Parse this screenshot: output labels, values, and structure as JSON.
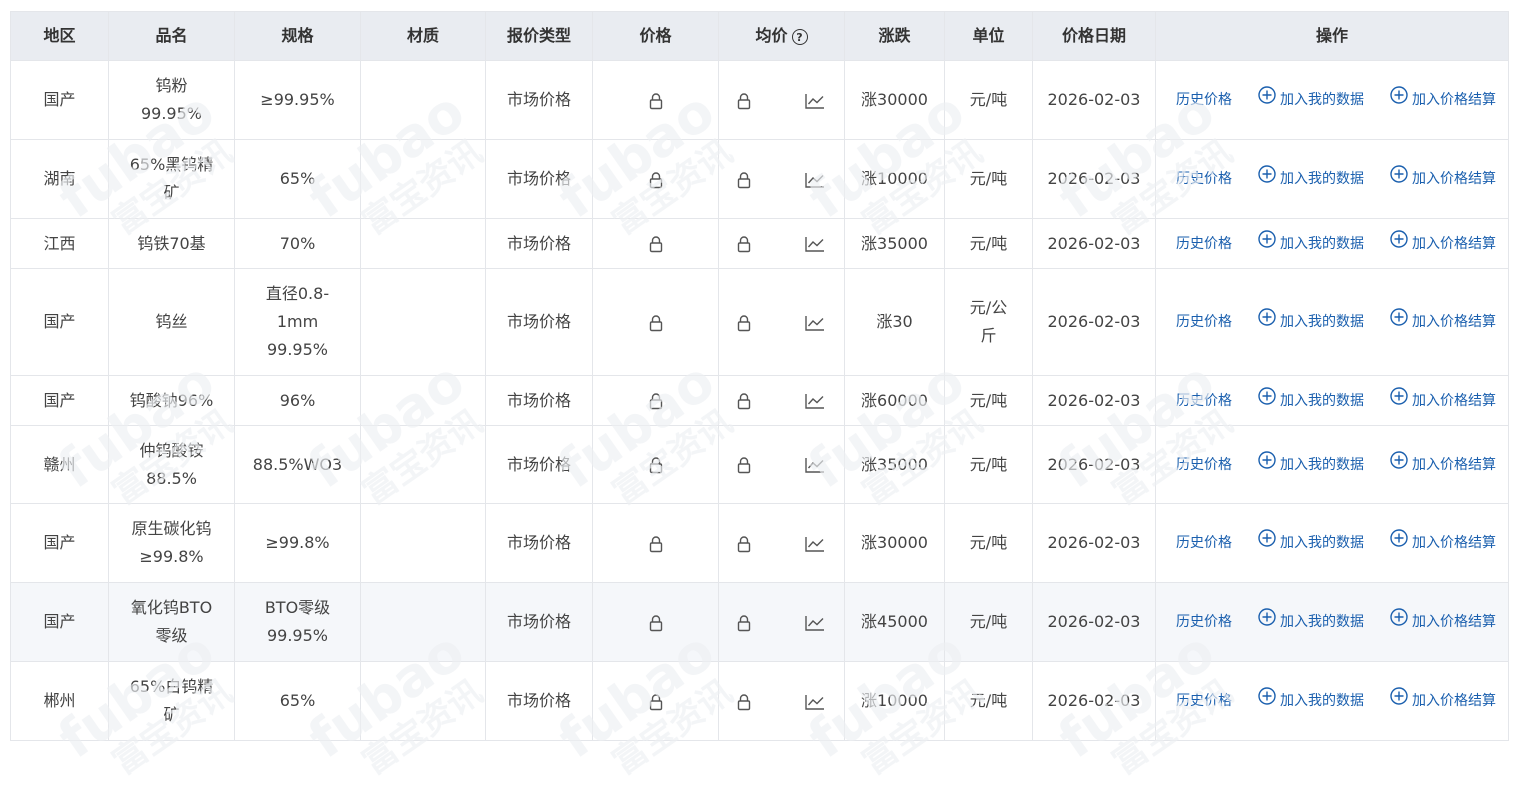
{
  "table": {
    "headers": [
      "地区",
      "品名",
      "规格",
      "材质",
      "报价类型",
      "价格",
      "均价",
      "涨跌",
      "单位",
      "价格日期",
      "操作"
    ],
    "help_glyph": "?",
    "actions": {
      "history": "历史价格",
      "add_data": "加入我的数据",
      "add_settle": "加入价格结算"
    },
    "rows": [
      {
        "region": "国产",
        "name": "钨粉\n99.95%",
        "spec": "≥99.95%",
        "material": "",
        "type": "市场价格",
        "change": "涨30000",
        "unit": "元/吨",
        "date": "2026-02-03",
        "h": 79
      },
      {
        "region": "湖南",
        "name": "65%黑钨精\n矿",
        "spec": "65%",
        "material": "",
        "type": "市场价格",
        "change": "涨10000",
        "unit": "元/吨",
        "date": "2026-02-03",
        "h": 79
      },
      {
        "region": "江西",
        "name": "钨铁70基",
        "spec": "70%",
        "material": "",
        "type": "市场价格",
        "change": "涨35000",
        "unit": "元/吨",
        "date": "2026-02-03",
        "h": 50
      },
      {
        "region": "国产",
        "name": "钨丝",
        "spec": "直径0.8-\n1mm\n99.95%",
        "material": "",
        "type": "市场价格",
        "change": "涨30",
        "unit": "元/公\n斤",
        "date": "2026-02-03",
        "h": 107
      },
      {
        "region": "国产",
        "name": "钨酸钠96%",
        "spec": "96%",
        "material": "",
        "type": "市场价格",
        "change": "涨60000",
        "unit": "元/吨",
        "date": "2026-02-03",
        "h": 50
      },
      {
        "region": "赣州",
        "name": "仲钨酸铵\n88.5%",
        "spec": "88.5%WO3",
        "material": "",
        "type": "市场价格",
        "change": "涨35000",
        "unit": "元/吨",
        "date": "2026-02-03",
        "h": 78
      },
      {
        "region": "国产",
        "name": "原生碳化钨\n≥99.8%",
        "spec": "≥99.8%",
        "material": "",
        "type": "市场价格",
        "change": "涨30000",
        "unit": "元/吨",
        "date": "2026-02-03",
        "h": 79
      },
      {
        "region": "国产",
        "name": "氧化钨BTO\n零级",
        "spec": "BTO零级\n99.95%",
        "material": "",
        "type": "市场价格",
        "change": "涨45000",
        "unit": "元/吨",
        "date": "2026-02-03",
        "h": 79,
        "highlight": true
      },
      {
        "region": "郴州",
        "name": "65%白钨精\n矿",
        "spec": "65%",
        "material": "",
        "type": "市场价格",
        "change": "涨10000",
        "unit": "元/吨",
        "date": "2026-02-03",
        "h": 79
      }
    ]
  },
  "watermark": {
    "brand": "fubao",
    "sub": "富宝资讯"
  },
  "colors": {
    "up": "#e0201c",
    "link": "#1a5fae",
    "header_bg": "#e9ecf1"
  }
}
